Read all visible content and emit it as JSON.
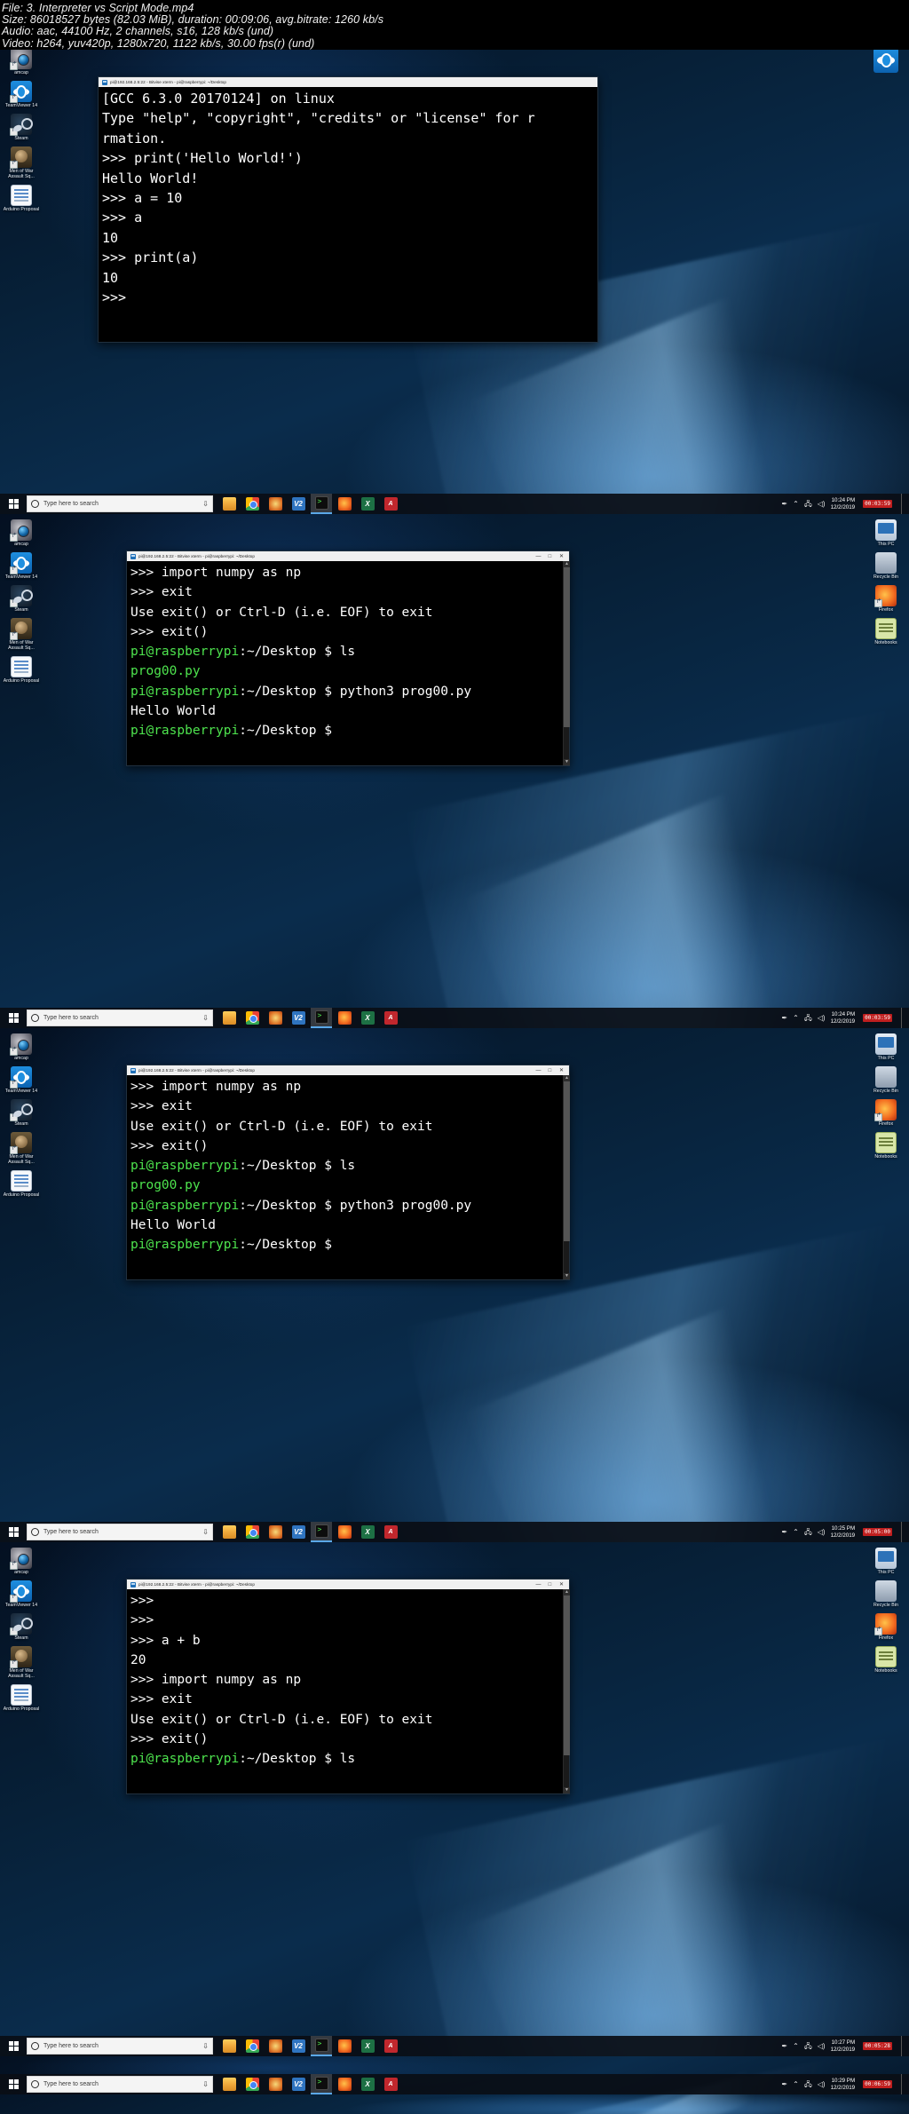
{
  "header": {
    "line1": "File: 3. Interpreter vs Script Mode.mp4",
    "line2": "Size: 86018527 bytes (82.03 MiB), duration: 00:09:06, avg.bitrate: 1260 kb/s",
    "line3": "Audio: aac, 44100 Hz, 2 channels, s16, 128 kb/s (und)",
    "line4": "Video: h264, yuv420p, 1280x720, 1122 kb/s, 30.00 fps(r) (und)"
  },
  "desktop_icons_left": [
    {
      "label": "amcap",
      "icon": "camera-icon"
    },
    {
      "label": "TeamViewer 14",
      "icon": "teamviewer-icon"
    },
    {
      "label": "Steam",
      "icon": "steam-icon"
    },
    {
      "label": "Men of War Assault Sq...",
      "icon": "men-of-war-icon"
    },
    {
      "label": "Arduino Proposal",
      "icon": "document-icon"
    }
  ],
  "desktop_icons_right": [
    {
      "label": "This PC",
      "icon": "this-pc-icon"
    },
    {
      "label": "Recycle Bin",
      "icon": "recycle-bin-icon"
    },
    {
      "label": "Firefox",
      "icon": "firefox-icon"
    },
    {
      "label": "Notebooks",
      "icon": "notes-icon"
    }
  ],
  "window": {
    "title": "pi@192.168.2.5:22 - Bitvise xterm - pi@raspberrypi: ~/Desktop",
    "minimize": "—",
    "maximize": "□",
    "close": "✕"
  },
  "taskbar": {
    "start_label": "Start",
    "search_placeholder": "Type here to search",
    "apps": [
      {
        "name": "file-explorer",
        "label": "File Explorer"
      },
      {
        "name": "google-chrome",
        "label": "Google Chrome"
      },
      {
        "name": "internet-explorer",
        "label": "Internet Explorer"
      },
      {
        "name": "v2-app",
        "label": "V2"
      },
      {
        "name": "bitvise-xterm",
        "label": "Bitvise xterm"
      },
      {
        "name": "firefox",
        "label": "Firefox"
      },
      {
        "name": "excel",
        "label": "Excel"
      },
      {
        "name": "pdf-reader",
        "label": "PDF Reader"
      }
    ],
    "v2_text": "V2",
    "excel_text": "X",
    "pdf_text": "A",
    "tray_icons": [
      "pen-icon",
      "chevron-up-icon",
      "network-icon",
      "volume-icon"
    ],
    "clocks": [
      "10:24 PM\n12/2/2019",
      "10:25 PM\n12/2/2019",
      "10:27 PM\n12/2/2019",
      "10:29 PM\n12/2/2019"
    ],
    "rec_badges": [
      "00:03:59",
      "00:05:00",
      "00:05:28",
      "00:06:59"
    ]
  },
  "frames": [
    {
      "id": "frame-1",
      "timestamp": "10:24 PM",
      "date": "12/2/2019",
      "rec": "00:03:59",
      "terminal_lines": [
        {
          "text": "[GCC 6.3.0 20170124] on linux",
          "color": "white"
        },
        {
          "text": "Type \"help\", \"copyright\", \"credits\" or \"license\" for more info",
          "color": "white"
        },
        {
          "text": "rmation.",
          "color": "white"
        },
        {
          "text": ">>> print('Hello World!')",
          "color": "white"
        },
        {
          "text": "Hello World!",
          "color": "white"
        },
        {
          "text": ">>> a = 10",
          "color": "white"
        },
        {
          "text": ">>> a",
          "color": "white"
        },
        {
          "text": "10",
          "color": "white"
        },
        {
          "text": ">>> print(a)",
          "color": "white"
        },
        {
          "text": "10",
          "color": "white"
        },
        {
          "text": ">>>",
          "color": "white"
        }
      ]
    },
    {
      "id": "frame-2",
      "timestamp": "10:24 PM",
      "date": "12/2/2019",
      "rec": "00:03:59",
      "terminal_lines": [
        {
          "text": ">>> import numpy as np",
          "color": "white"
        },
        {
          "text": ">>> exit",
          "color": "white"
        },
        {
          "text": "Use exit() or Ctrl-D (i.e. EOF) to exit",
          "color": "white"
        },
        {
          "text": ">>> exit()",
          "color": "white"
        },
        {
          "prompt": "pi@raspberrypi",
          "path": ":~/Desktop $ ",
          "cmd": "ls",
          "color": "green-prompt"
        },
        {
          "text": "prog00.py",
          "color": "green"
        },
        {
          "prompt": "pi@raspberrypi",
          "path": ":~/Desktop $ ",
          "cmd": "python3 prog00.py",
          "color": "green-prompt"
        },
        {
          "text": "Hello World",
          "color": "white"
        },
        {
          "prompt": "pi@raspberrypi",
          "path": ":~/Desktop $ ",
          "cmd": "",
          "color": "green-prompt"
        }
      ]
    },
    {
      "id": "frame-3",
      "timestamp": "10:25 PM",
      "date": "12/2/2019",
      "rec": "00:05:00",
      "terminal_lines": [
        {
          "text": ">>> import numpy as np",
          "color": "white"
        },
        {
          "text": ">>> exit",
          "color": "white"
        },
        {
          "text": "Use exit() or Ctrl-D (i.e. EOF) to exit",
          "color": "white"
        },
        {
          "text": ">>> exit()",
          "color": "white"
        },
        {
          "prompt": "pi@raspberrypi",
          "path": ":~/Desktop $ ",
          "cmd": "ls",
          "color": "green-prompt"
        },
        {
          "text": "prog00.py",
          "color": "green"
        },
        {
          "prompt": "pi@raspberrypi",
          "path": ":~/Desktop $ ",
          "cmd": "python3 prog00.py",
          "color": "green-prompt"
        },
        {
          "text": "Hello World",
          "color": "white"
        },
        {
          "prompt": "pi@raspberrypi",
          "path": ":~/Desktop $ ",
          "cmd": "",
          "color": "green-prompt"
        }
      ]
    },
    {
      "id": "frame-4",
      "timestamp": "10:27 PM",
      "date": "12/2/2019",
      "rec": "00:05:28",
      "terminal_lines": [
        {
          "text": ">>>",
          "color": "white"
        },
        {
          "text": ">>>",
          "color": "white"
        },
        {
          "text": ">>> a + b",
          "color": "white"
        },
        {
          "text": "20",
          "color": "white"
        },
        {
          "text": ">>> import numpy as np",
          "color": "white"
        },
        {
          "text": ">>> exit",
          "color": "white"
        },
        {
          "text": "Use exit() or Ctrl-D (i.e. EOF) to exit",
          "color": "white"
        },
        {
          "text": ">>> exit()",
          "color": "white"
        },
        {
          "prompt": "pi@raspberrypi",
          "path": ":~/Desktop $ ",
          "cmd": "ls",
          "color": "green-prompt"
        }
      ]
    },
    {
      "id": "frame-5",
      "timestamp": "10:29 PM",
      "date": "12/2/2019",
      "rec": "00:06:59",
      "terminal_lines": []
    }
  ]
}
